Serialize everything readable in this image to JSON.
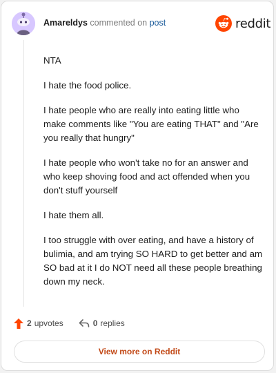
{
  "header": {
    "username": "Amareldys",
    "action_text": "commented on",
    "post_link": "post"
  },
  "logo": {
    "wordmark": "reddit",
    "icon": "reddit-alien-icon"
  },
  "comment": {
    "paragraphs": [
      "NTA",
      "I hate the food police.",
      "I hate people who are really into eating little who make comments like \"You are eating THAT\" and \"Are you really that hungry\"",
      "I hate people who won't take no for an answer and who keep shoving food and act offended when you don't stuff yourself",
      "I hate them all.",
      "I too struggle with over eating, and have a history of bulimia, and am trying SO HARD to get better and am SO bad at it I do NOT need all these people breathing down my neck."
    ]
  },
  "actions": {
    "upvotes_count": "2",
    "upvotes_label": "upvotes",
    "replies_count": "0",
    "replies_label": "replies"
  },
  "footer": {
    "view_more_label": "View more on Reddit"
  },
  "colors": {
    "brand_orange": "#ff4500",
    "upvote": "#ff4500",
    "view_more_text": "#c24917",
    "post_link": "#1a5a9a"
  }
}
